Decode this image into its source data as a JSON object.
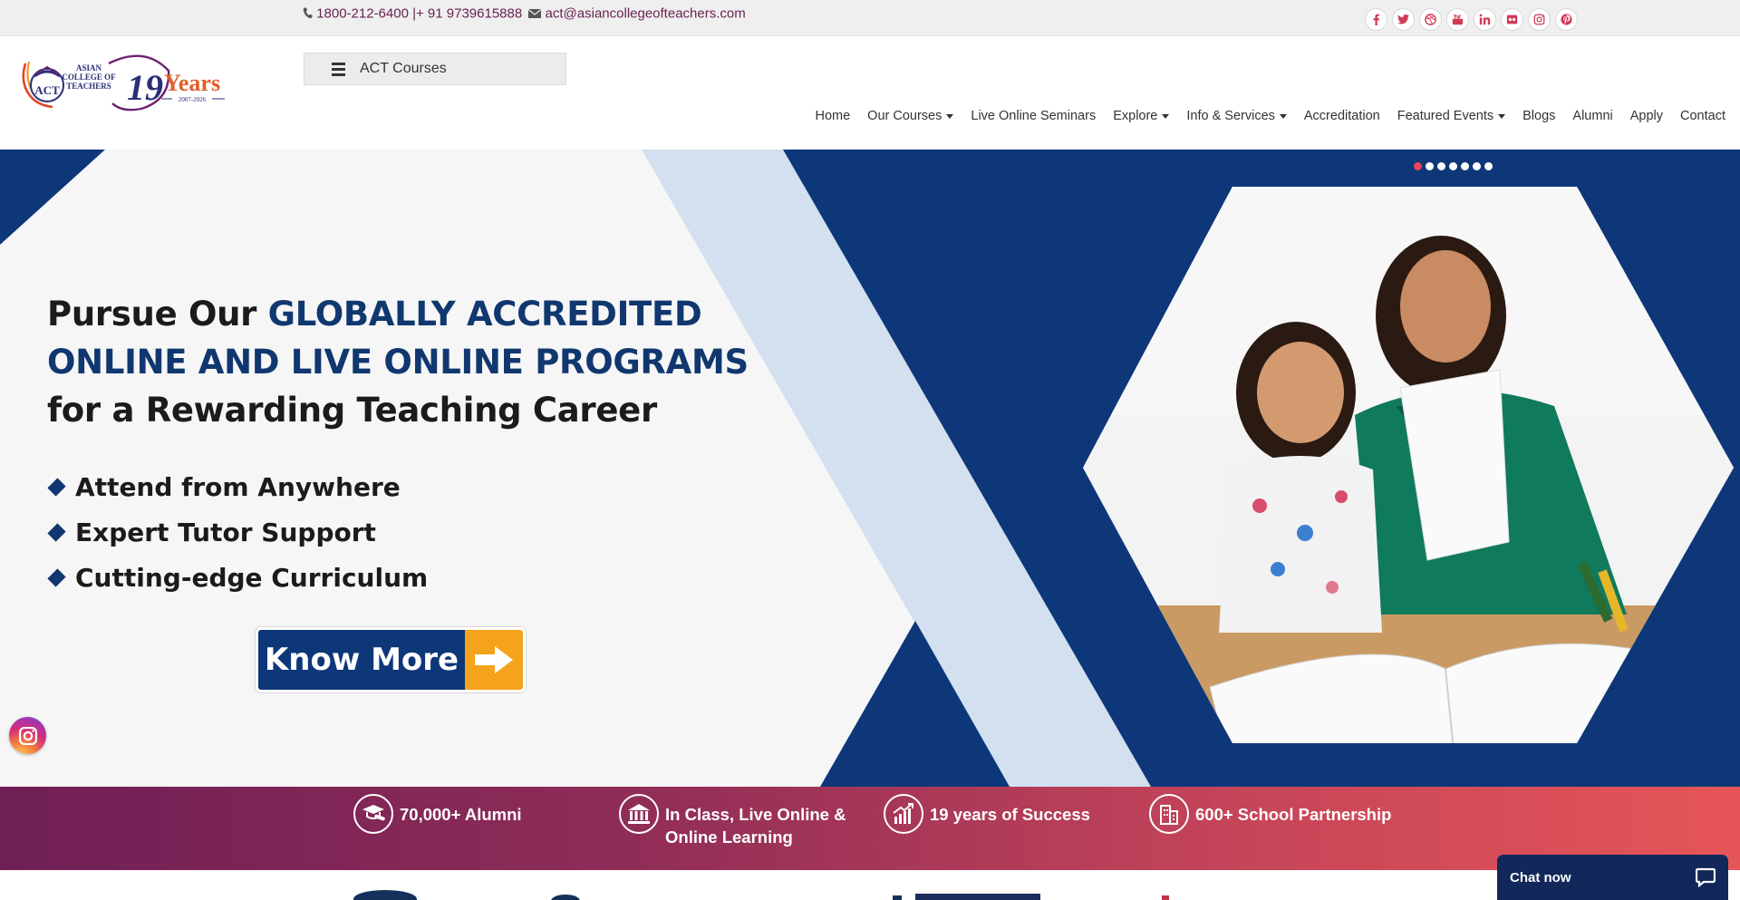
{
  "topbar": {
    "phone": "1800-212-6400 |+ 91 9739615888",
    "email": "act@asiancollegeofteachers.com",
    "socials": [
      "facebook-icon",
      "twitter-icon",
      "dribbble-icon",
      "youtube-icon",
      "linkedin-icon",
      "flickr-icon",
      "instagram-icon",
      "pinterest-icon"
    ]
  },
  "header": {
    "logo": {
      "line1": "ASIAN",
      "line2": "COLLEGE OF",
      "line3": "TEACHERS",
      "emblem": "ACT",
      "years_num": "19",
      "years_word": "Years",
      "period": "2007-2026"
    },
    "courses_button": "ACT Courses",
    "nav": [
      {
        "label": "Home",
        "dropdown": false
      },
      {
        "label": "Our Courses",
        "dropdown": true
      },
      {
        "label": "Live Online Seminars",
        "dropdown": false
      },
      {
        "label": "Explore",
        "dropdown": true
      },
      {
        "label": "Info & Services",
        "dropdown": true
      },
      {
        "label": "Accreditation",
        "dropdown": false
      },
      {
        "label": "Featured Events",
        "dropdown": true
      },
      {
        "label": "Blogs",
        "dropdown": false
      },
      {
        "label": "Alumni",
        "dropdown": false
      },
      {
        "label": "Apply",
        "dropdown": false
      },
      {
        "label": "Contact",
        "dropdown": false
      }
    ]
  },
  "hero": {
    "headline_pre": "Pursue Our ",
    "headline_highlight_1": "GLOBALLY ACCREDITED",
    "headline_highlight_2": "ONLINE AND LIVE ONLINE PROGRAMS",
    "headline_post": "for a Rewarding Teaching Career",
    "bullets": [
      "Attend from Anywhere",
      "Expert Tutor Support",
      "Cutting-edge Curriculum"
    ],
    "cta": "Know More",
    "slides_total": 7,
    "active_slide": 1,
    "colors": {
      "navy": "#0d3779",
      "light_band": "#d3e0f0",
      "accent_orange": "#f5a31a"
    }
  },
  "stats": [
    {
      "icon": "graduation-scroll-icon",
      "label": "70,000+ Alumni"
    },
    {
      "icon": "institution-icon",
      "label_line1": "In Class, Live Online &",
      "label_line2": "Online Learning"
    },
    {
      "icon": "growth-chart-icon",
      "label": "19 years of Success"
    },
    {
      "icon": "buildings-icon",
      "label": "600+ School Partnership"
    }
  ],
  "chat": {
    "label": "Chat now"
  }
}
